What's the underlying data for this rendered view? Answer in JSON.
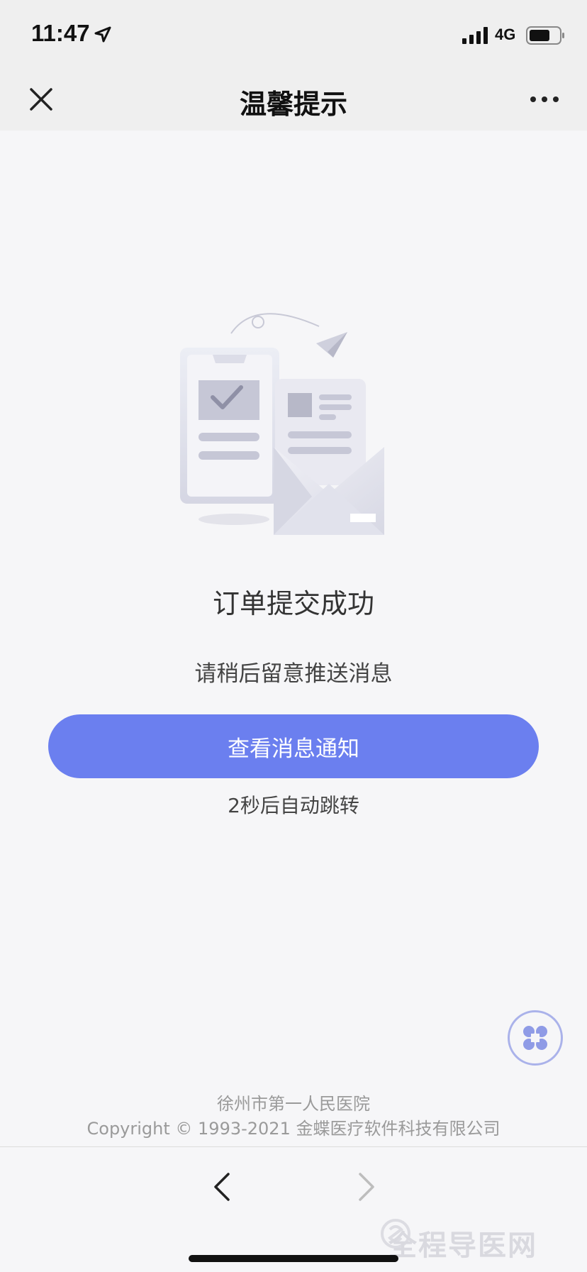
{
  "status_bar": {
    "time": "11:47",
    "network": "4G",
    "icons": [
      "location-arrow-icon",
      "signal-icon",
      "battery-icon"
    ]
  },
  "nav": {
    "title": "温馨提示",
    "close_icon": "close-icon",
    "more_icon": "more-icon"
  },
  "result": {
    "title": "订单提交成功",
    "subtitle": "请稍后留意推送消息",
    "button_label": "查看消息通知",
    "countdown": "2秒后自动跳转"
  },
  "footer": {
    "organization": "徐州市第一人民医院",
    "copyright": "Copyright © 1993-2021 金蝶医疗软件科技有限公司"
  },
  "bottom_nav": {
    "back_icon": "chevron-left-icon",
    "forward_icon": "chevron-right-icon"
  },
  "watermark": "全程导医网",
  "colors": {
    "accent": "#6b7fef",
    "background": "#f6f6f8",
    "bar": "#efefef"
  }
}
